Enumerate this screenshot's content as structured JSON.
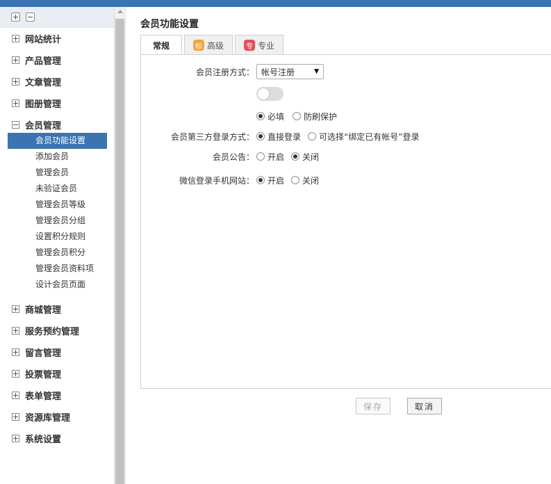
{
  "sidebar": {
    "groups": [
      {
        "label": "网站统计",
        "expanded": false
      },
      {
        "label": "产品管理",
        "expanded": false
      },
      {
        "label": "文章管理",
        "expanded": false
      },
      {
        "label": "图册管理",
        "expanded": false
      },
      {
        "label": "会员管理",
        "expanded": true
      },
      {
        "label": "商城管理",
        "expanded": false
      },
      {
        "label": "服务预约管理",
        "expanded": false
      },
      {
        "label": "留言管理",
        "expanded": false
      },
      {
        "label": "投票管理",
        "expanded": false
      },
      {
        "label": "表单管理",
        "expanded": false
      },
      {
        "label": "资源库管理",
        "expanded": false
      },
      {
        "label": "系统设置",
        "expanded": false
      }
    ],
    "member_items": [
      {
        "label": "会员功能设置",
        "active": true
      },
      {
        "label": "添加会员"
      },
      {
        "label": "管理会员"
      },
      {
        "label": "未验证会员"
      },
      {
        "label": "管理会员等级"
      },
      {
        "label": "管理会员分组"
      },
      {
        "label": "设置积分规则"
      },
      {
        "label": "管理会员积分"
      },
      {
        "label": "管理会员资料项"
      },
      {
        "label": "设计会员页面"
      }
    ]
  },
  "main": {
    "title": "会员功能设置",
    "tabs": [
      {
        "label": "常规",
        "active": true
      },
      {
        "label": "高级",
        "badge": "标"
      },
      {
        "label": "专业",
        "badge": "专"
      }
    ],
    "form": {
      "registration": {
        "label": "会员注册方式：",
        "select_value": "帐号注册",
        "toggle_on": false,
        "options": [
          "必填",
          "防刷保护"
        ],
        "selected": "必填"
      },
      "third_party": {
        "label": "会员第三方登录方式：",
        "options": [
          "直接登录",
          "可选择“绑定已有帐号”登录"
        ],
        "selected": "直接登录"
      },
      "notice": {
        "label": "会员公告：",
        "options": [
          "开启",
          "关闭"
        ],
        "selected": "关闭"
      },
      "wechat": {
        "label": "微信登录手机网站：",
        "options": [
          "开启",
          "关闭"
        ],
        "selected": "开启"
      }
    },
    "buttons": {
      "save": "保存",
      "cancel": "取消"
    }
  },
  "colors": {
    "topbar": "#3a74b3",
    "active_item": "#3b74b1",
    "badge_advanced": "#f5a53b",
    "badge_pro": "#e5505a"
  }
}
